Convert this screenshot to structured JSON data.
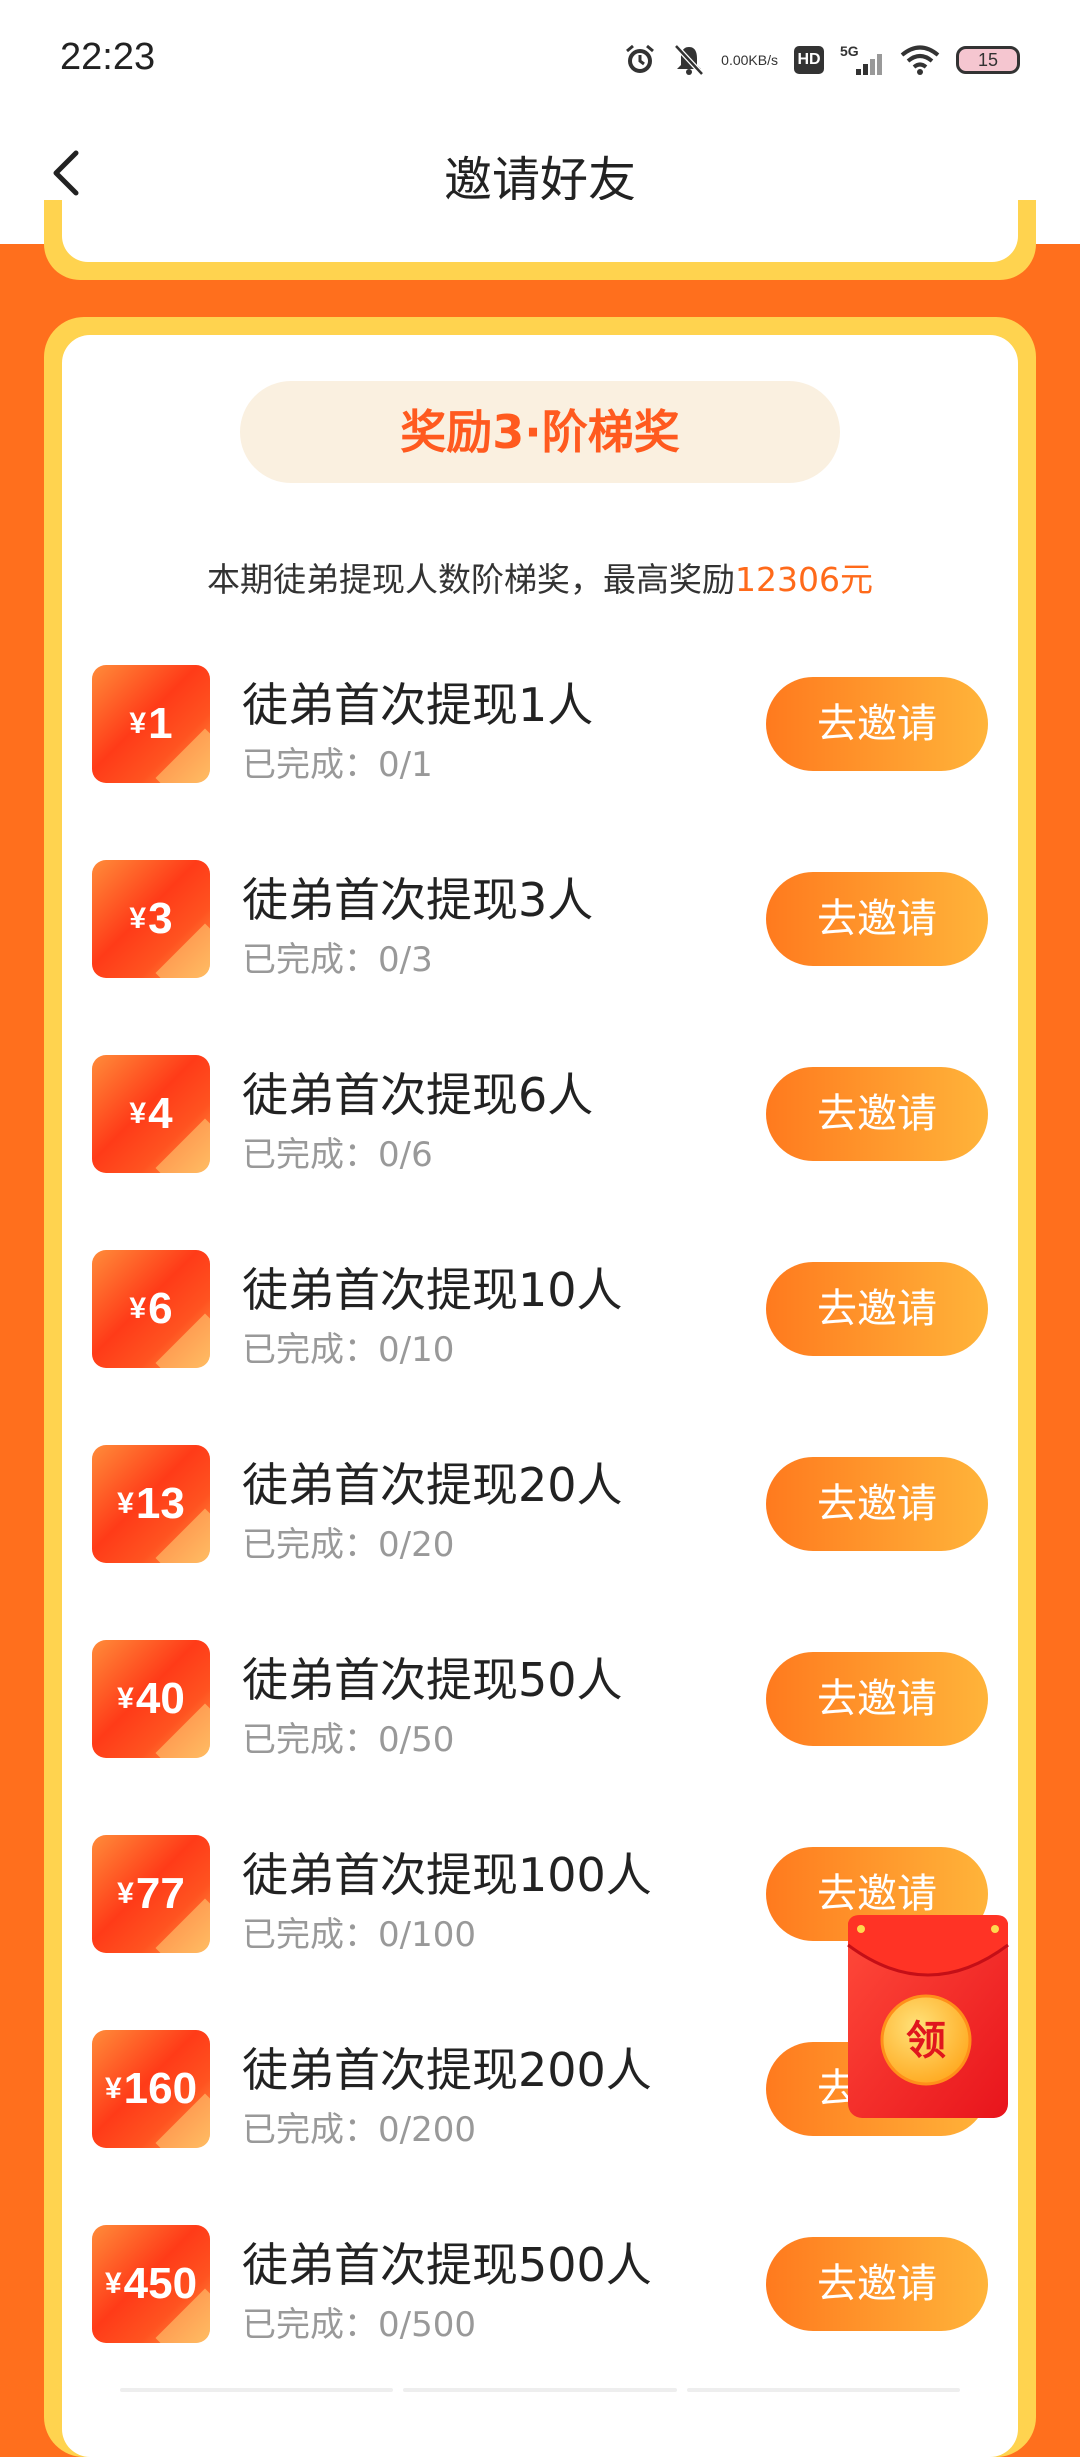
{
  "status_bar": {
    "time": "22:23",
    "net_speed_value": "0.00",
    "net_speed_unit": "KB/s",
    "hd_label": "HD",
    "signal_label": "5G",
    "battery": "15"
  },
  "nav": {
    "title": "邀请好友"
  },
  "section": {
    "title": "奖励3·阶梯奖",
    "subtitle_prefix": "本期徒弟提现人数阶梯奖，最高奖励",
    "subtitle_highlight": "12306元"
  },
  "tasks": [
    {
      "yen": "¥",
      "amount": "1",
      "title": "徒弟首次提现1人",
      "progress": "已完成：0/1",
      "button": "去邀请"
    },
    {
      "yen": "¥",
      "amount": "3",
      "title": "徒弟首次提现3人",
      "progress": "已完成：0/3",
      "button": "去邀请"
    },
    {
      "yen": "¥",
      "amount": "4",
      "title": "徒弟首次提现6人",
      "progress": "已完成：0/6",
      "button": "去邀请"
    },
    {
      "yen": "¥",
      "amount": "6",
      "title": "徒弟首次提现10人",
      "progress": "已完成：0/10",
      "button": "去邀请"
    },
    {
      "yen": "¥",
      "amount": "13",
      "title": "徒弟首次提现20人",
      "progress": "已完成：0/20",
      "button": "去邀请"
    },
    {
      "yen": "¥",
      "amount": "40",
      "title": "徒弟首次提现50人",
      "progress": "已完成：0/50",
      "button": "去邀请"
    },
    {
      "yen": "¥",
      "amount": "77",
      "title": "徒弟首次提现100人",
      "progress": "已完成：0/100",
      "button": "去邀请"
    },
    {
      "yen": "¥",
      "amount": "160",
      "title": "徒弟首次提现200人",
      "progress": "已完成：0/200",
      "button": "去邀请"
    },
    {
      "yen": "¥",
      "amount": "450",
      "title": "徒弟首次提现500人",
      "progress": "已完成：0/500",
      "button": "去邀请"
    }
  ],
  "red_packet": {
    "label": "领"
  },
  "colors": {
    "page_background": "#ff6f1d",
    "card_border": "#ffd34f",
    "accent": "#ff6a1a",
    "title_pill_bg": "#faf0e0"
  }
}
